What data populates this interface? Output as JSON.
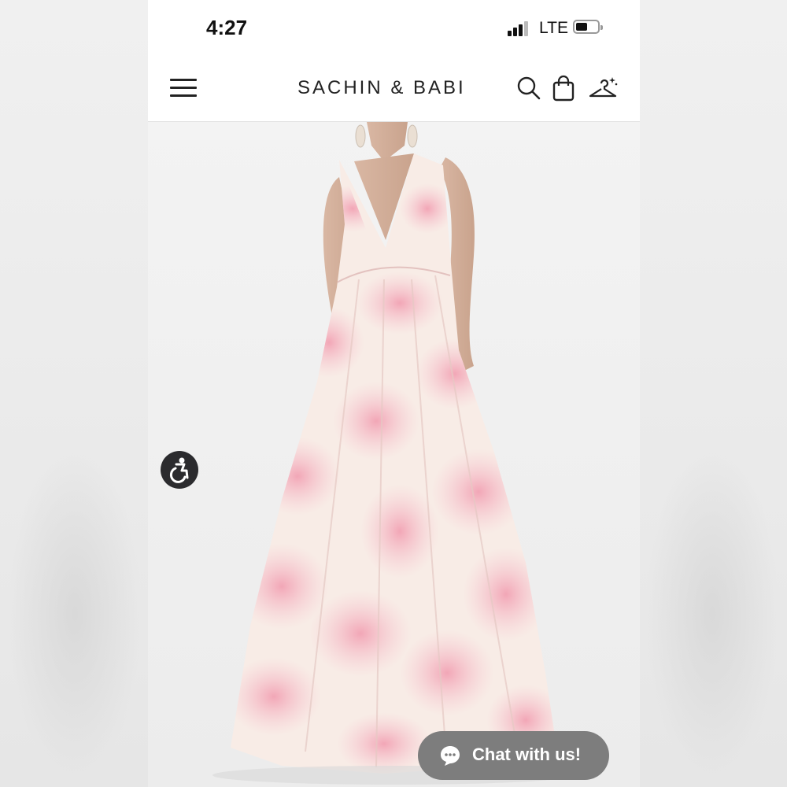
{
  "status_bar": {
    "time": "4:27",
    "network": "LTE",
    "icons": [
      "signal-icon",
      "battery-icon"
    ]
  },
  "header": {
    "brand": "SACHIN & BABI",
    "icons": [
      "hamburger-menu-icon",
      "search-icon",
      "shopping-bag-icon",
      "hanger-icon"
    ]
  },
  "product_image": {
    "description_icon": "product-photo",
    "colors": {
      "dress_pink": "#f2a8b8",
      "dress_cream": "#f8ede0",
      "background": "#efefef"
    }
  },
  "accessibility": {
    "icon": "accessibility-icon"
  },
  "chat": {
    "label": "Chat with us!",
    "icon": "chat-bubble-icon"
  },
  "colors": {
    "chat_button": "#7d7d7d",
    "accessibility_button": "#2b2b2e"
  }
}
